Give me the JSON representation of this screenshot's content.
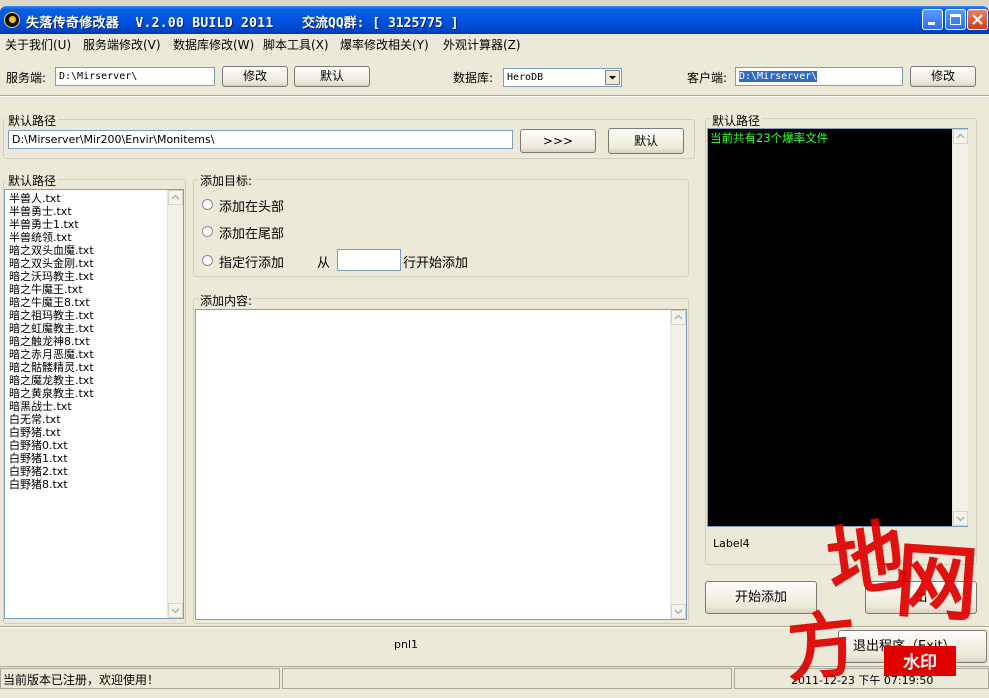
{
  "window": {
    "title": "失落传奇修改器  V.2.00 BUILD 2011",
    "title_qq": "交流QQ群: [ 3125775 ]"
  },
  "menu": [
    "关于我们(U)",
    "服务端修改(V)",
    "数据库修改(W)",
    "脚本工具(X)",
    "爆率修改相关(Y)",
    "外观计算器(Z)"
  ],
  "toolbar": {
    "server_label": "服务端:",
    "server_value": "D:\\Mirserver\\",
    "modify_label": "修改",
    "default_label": "默认",
    "db_label": "数据库:",
    "db_value": "HeroDB",
    "client_label": "客户端:",
    "client_value": "D:\\Mirserver\\",
    "client_modify_label": "修改"
  },
  "path_group": {
    "label": "默认路径",
    "value": "D:\\Mirserver\\Mir200\\Envir\\Monitems\\",
    "go_label": ">>>",
    "default_label": "默认"
  },
  "files_group": {
    "label": "默认路径",
    "files": [
      "半兽人.txt",
      "半兽勇士.txt",
      "半兽勇士1.txt",
      "半兽统领.txt",
      "暗之双头血魔.txt",
      "暗之双头金刚.txt",
      "暗之沃玛教主.txt",
      "暗之牛魔王.txt",
      "暗之牛魔王8.txt",
      "暗之祖玛教主.txt",
      "暗之虹魔教主.txt",
      "暗之触龙神8.txt",
      "暗之赤月恶魔.txt",
      "暗之骷髅精灵.txt",
      "暗之魔龙教主.txt",
      "暗之黄泉教主.txt",
      "暗黑战士.txt",
      "白无常.txt",
      "白野猪.txt",
      "白野猪0.txt",
      "白野猪1.txt",
      "白野猪2.txt",
      "白野猪8.txt"
    ]
  },
  "target_group": {
    "label": "添加目标:",
    "opt_head": "添加在头部",
    "opt_tail": "添加在尾部",
    "opt_line": "指定行添加",
    "from_label": "从",
    "line_value": "",
    "suffix_label": "行开始添加"
  },
  "content_group": {
    "label": "添加内容:",
    "value": ""
  },
  "right_group": {
    "label": "默认路径",
    "console_text": "当前共有23个爆率文件",
    "label4": "Label4",
    "start_label": "开始添加",
    "exit_partial": "出",
    "exit_label": "退出程序（Exit）"
  },
  "panel": {
    "label": "pnl1"
  },
  "status": {
    "message": "当前版本已注册，欢迎使用！",
    "datetime": "2011-12-23 下午 07:19:50"
  },
  "watermark": {
    "text": "地方网",
    "badge": "水印"
  },
  "colors": {
    "console_bg": "#000000",
    "console_text": "#33ff33",
    "titlebar": "#0054e3",
    "watermark": "#e00000"
  }
}
